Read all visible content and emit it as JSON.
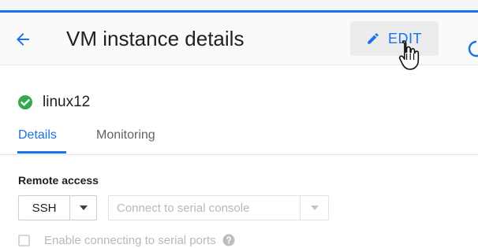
{
  "header": {
    "title": "VM instance details",
    "edit_label": "EDIT"
  },
  "instance": {
    "name": "linux12",
    "status_icon": "check-circle-icon",
    "status_color": "#34a853"
  },
  "tabs": [
    {
      "label": "Details",
      "active": true
    },
    {
      "label": "Monitoring",
      "active": false
    }
  ],
  "remote_access": {
    "label": "Remote access",
    "ssh_value": "SSH",
    "serial_console_value": "Connect to serial console",
    "serial_ports_label": "Enable connecting to serial ports"
  },
  "colors": {
    "accent": "#1a73e8",
    "disabled_text": "#b9b9b9"
  },
  "icons": {
    "back": "arrow-left-icon",
    "edit": "pencil-icon",
    "refresh": "refresh-icon",
    "help": "help-icon",
    "cursor": "hand-pointer-icon"
  }
}
